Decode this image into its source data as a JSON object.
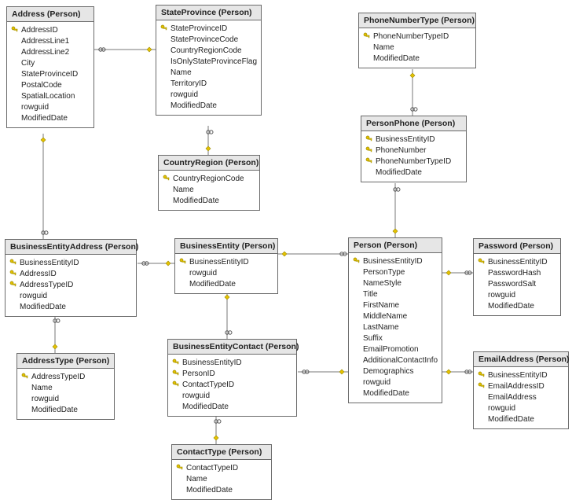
{
  "tables": {
    "address": {
      "title": "Address (Person)",
      "cols": [
        {
          "k": true,
          "n": "AddressID"
        },
        {
          "k": false,
          "n": "AddressLine1"
        },
        {
          "k": false,
          "n": "AddressLine2"
        },
        {
          "k": false,
          "n": "City"
        },
        {
          "k": false,
          "n": "StateProvinceID"
        },
        {
          "k": false,
          "n": "PostalCode"
        },
        {
          "k": false,
          "n": "SpatialLocation"
        },
        {
          "k": false,
          "n": "rowguid"
        },
        {
          "k": false,
          "n": "ModifiedDate"
        }
      ]
    },
    "stateprovince": {
      "title": "StateProvince (Person)",
      "cols": [
        {
          "k": true,
          "n": "StateProvinceID"
        },
        {
          "k": false,
          "n": "StateProvinceCode"
        },
        {
          "k": false,
          "n": "CountryRegionCode"
        },
        {
          "k": false,
          "n": "IsOnlyStateProvinceFlag"
        },
        {
          "k": false,
          "n": "Name"
        },
        {
          "k": false,
          "n": "TerritoryID"
        },
        {
          "k": false,
          "n": "rowguid"
        },
        {
          "k": false,
          "n": "ModifiedDate"
        }
      ]
    },
    "phonenumbertype": {
      "title": "PhoneNumberType (Person)",
      "cols": [
        {
          "k": true,
          "n": "PhoneNumberTypeID"
        },
        {
          "k": false,
          "n": "Name"
        },
        {
          "k": false,
          "n": "ModifiedDate"
        }
      ]
    },
    "personphone": {
      "title": "PersonPhone (Person)",
      "cols": [
        {
          "k": true,
          "n": "BusinessEntityID"
        },
        {
          "k": true,
          "n": "PhoneNumber"
        },
        {
          "k": true,
          "n": "PhoneNumberTypeID"
        },
        {
          "k": false,
          "n": "ModifiedDate"
        }
      ]
    },
    "countryregion": {
      "title": "CountryRegion (Person)",
      "cols": [
        {
          "k": true,
          "n": "CountryRegionCode"
        },
        {
          "k": false,
          "n": "Name"
        },
        {
          "k": false,
          "n": "ModifiedDate"
        }
      ]
    },
    "businessentityaddress": {
      "title": "BusinessEntityAddress (Person)",
      "cols": [
        {
          "k": true,
          "n": "BusinessEntityID"
        },
        {
          "k": true,
          "n": "AddressID"
        },
        {
          "k": true,
          "n": "AddressTypeID"
        },
        {
          "k": false,
          "n": "rowguid"
        },
        {
          "k": false,
          "n": "ModifiedDate"
        }
      ]
    },
    "businessentity": {
      "title": "BusinessEntity (Person)",
      "cols": [
        {
          "k": true,
          "n": "BusinessEntityID"
        },
        {
          "k": false,
          "n": "rowguid"
        },
        {
          "k": false,
          "n": "ModifiedDate"
        }
      ]
    },
    "person": {
      "title": "Person (Person)",
      "cols": [
        {
          "k": true,
          "n": "BusinessEntityID"
        },
        {
          "k": false,
          "n": "PersonType"
        },
        {
          "k": false,
          "n": "NameStyle"
        },
        {
          "k": false,
          "n": "Title"
        },
        {
          "k": false,
          "n": "FirstName"
        },
        {
          "k": false,
          "n": "MiddleName"
        },
        {
          "k": false,
          "n": "LastName"
        },
        {
          "k": false,
          "n": "Suffix"
        },
        {
          "k": false,
          "n": "EmailPromotion"
        },
        {
          "k": false,
          "n": "AdditionalContactInfo"
        },
        {
          "k": false,
          "n": "Demographics"
        },
        {
          "k": false,
          "n": "rowguid"
        },
        {
          "k": false,
          "n": "ModifiedDate"
        }
      ]
    },
    "password": {
      "title": "Password (Person)",
      "cols": [
        {
          "k": true,
          "n": "BusinessEntityID"
        },
        {
          "k": false,
          "n": "PasswordHash"
        },
        {
          "k": false,
          "n": "PasswordSalt"
        },
        {
          "k": false,
          "n": "rowguid"
        },
        {
          "k": false,
          "n": "ModifiedDate"
        }
      ]
    },
    "addresstype": {
      "title": "AddressType (Person)",
      "cols": [
        {
          "k": true,
          "n": "AddressTypeID"
        },
        {
          "k": false,
          "n": "Name"
        },
        {
          "k": false,
          "n": "rowguid"
        },
        {
          "k": false,
          "n": "ModifiedDate"
        }
      ]
    },
    "businessentitycontact": {
      "title": "BusinessEntityContact (Person)",
      "cols": [
        {
          "k": true,
          "n": "BusinessEntityID"
        },
        {
          "k": true,
          "n": "PersonID"
        },
        {
          "k": true,
          "n": "ContactTypeID"
        },
        {
          "k": false,
          "n": "rowguid"
        },
        {
          "k": false,
          "n": "ModifiedDate"
        }
      ]
    },
    "emailaddress": {
      "title": "EmailAddress (Person)",
      "cols": [
        {
          "k": true,
          "n": "BusinessEntityID"
        },
        {
          "k": true,
          "n": "EmailAddressID"
        },
        {
          "k": false,
          "n": "EmailAddress"
        },
        {
          "k": false,
          "n": "rowguid"
        },
        {
          "k": false,
          "n": "ModifiedDate"
        }
      ]
    },
    "contacttype": {
      "title": "ContactType (Person)",
      "cols": [
        {
          "k": true,
          "n": "ContactTypeID"
        },
        {
          "k": false,
          "n": "Name"
        },
        {
          "k": false,
          "n": "ModifiedDate"
        }
      ]
    }
  },
  "relationships": [
    {
      "from": "Address",
      "to": "StateProvince"
    },
    {
      "from": "StateProvince",
      "to": "CountryRegion"
    },
    {
      "from": "BusinessEntityAddress",
      "to": "Address"
    },
    {
      "from": "BusinessEntityAddress",
      "to": "AddressType"
    },
    {
      "from": "BusinessEntityAddress",
      "to": "BusinessEntity"
    },
    {
      "from": "BusinessEntityContact",
      "to": "BusinessEntity"
    },
    {
      "from": "BusinessEntityContact",
      "to": "Person"
    },
    {
      "from": "BusinessEntityContact",
      "to": "ContactType"
    },
    {
      "from": "Person",
      "to": "BusinessEntity"
    },
    {
      "from": "PersonPhone",
      "to": "PhoneNumberType"
    },
    {
      "from": "PersonPhone",
      "to": "Person"
    },
    {
      "from": "Password",
      "to": "Person"
    },
    {
      "from": "EmailAddress",
      "to": "Person"
    }
  ]
}
